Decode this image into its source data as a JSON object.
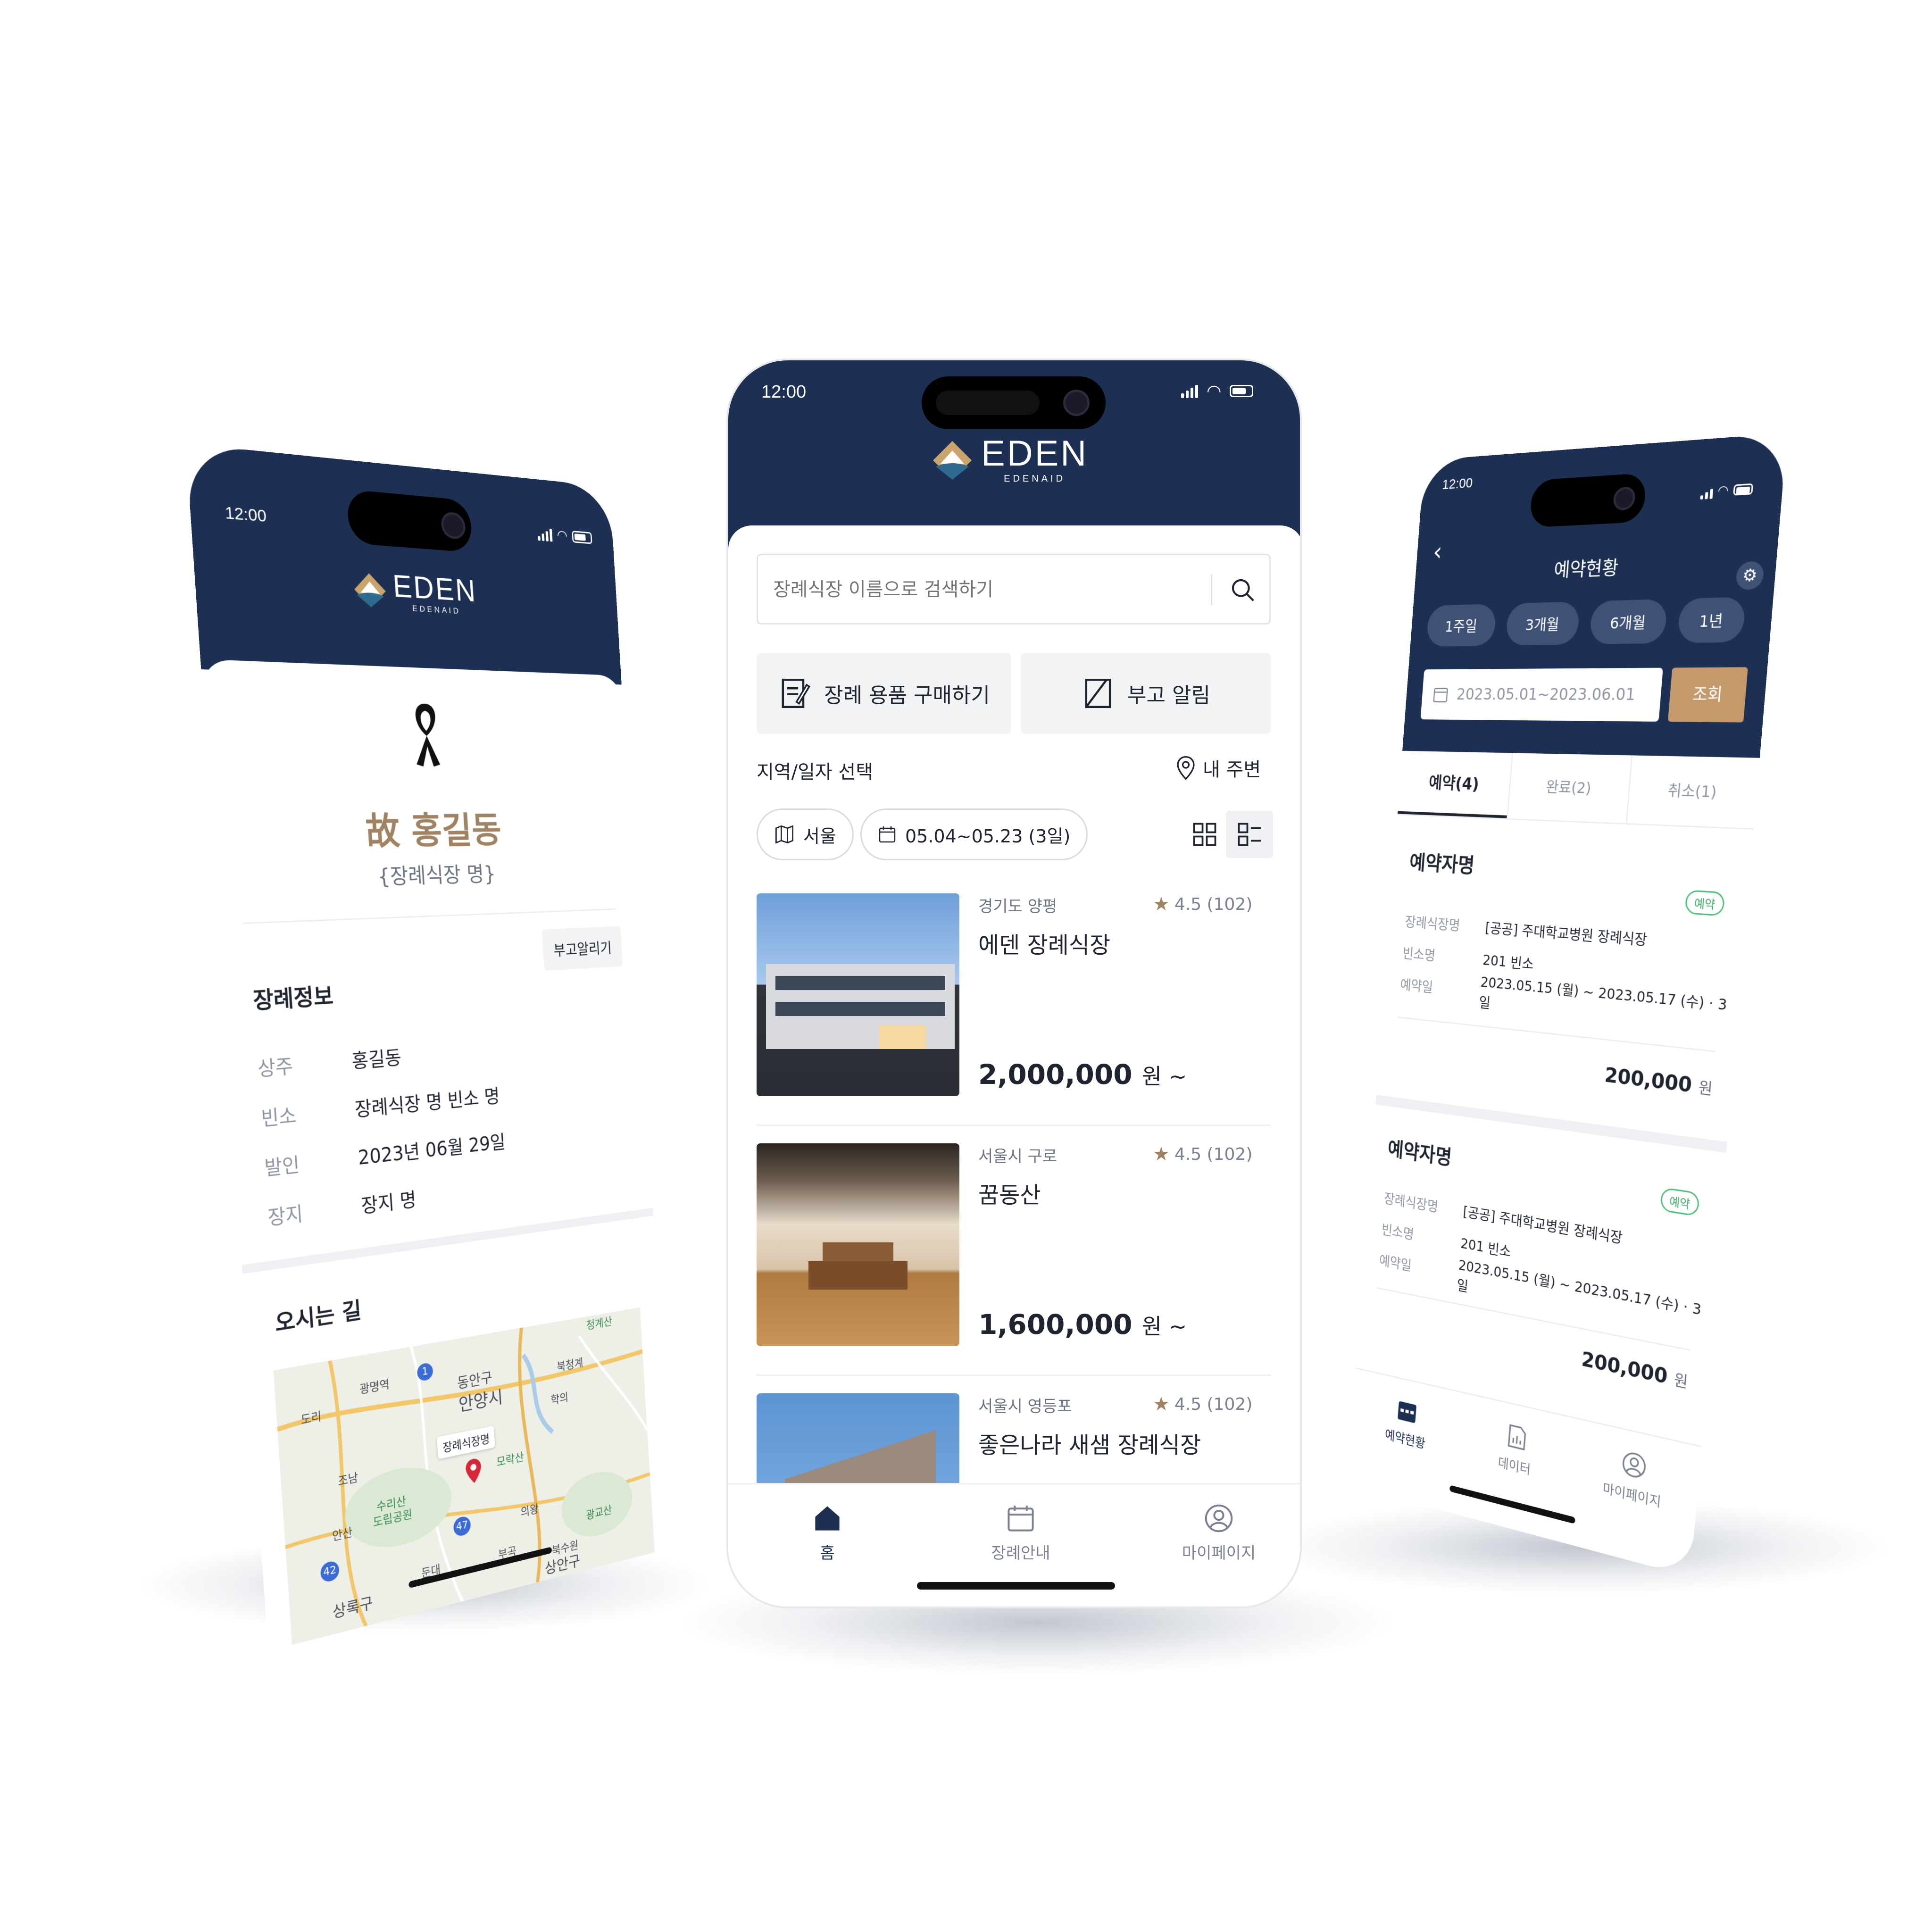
{
  "status_time": "12:00",
  "brand": {
    "name": "EDEN",
    "sub": "EDENAID"
  },
  "left_phone": {
    "deceased_name": "故 홍길동",
    "funeral_hall": "{장례식장 명}",
    "notify_button": "부고알리기",
    "info_title": "장례정보",
    "rows": [
      {
        "label": "상주",
        "value": "홍길동"
      },
      {
        "label": "빈소",
        "value": "장례식장 명 빈소 명"
      },
      {
        "label": "발인",
        "value": "2023년 06월 29일"
      },
      {
        "label": "장지",
        "value": "장지 명"
      }
    ],
    "directions_title": "오시는 길",
    "map": {
      "pin_label": "장례식장명",
      "places": [
        "청계산",
        "광명역",
        "안양시",
        "동안구",
        "북청계",
        "학의",
        "조남",
        "도리",
        "모락산",
        "수리산",
        "도립공원",
        "안산",
        "의왕",
        "광교산",
        "상록구",
        "둔대",
        "부곡",
        "북수원",
        "상안구",
        "1",
        "42",
        "47"
      ]
    }
  },
  "center_phone": {
    "search_placeholder": "장례식장 이름으로 검색하기",
    "buy_goods": "장례 용품 구매하기",
    "obituary": "부고 알림",
    "filter_label": "지역/일자 선택",
    "nearby": "내 주변",
    "region_chip": "서울",
    "date_chip": "05.04~05.23 (3일)",
    "listings": [
      {
        "region": "경기도 양평",
        "name": "에덴 장례식장",
        "rating": "4.5 (102)",
        "price": "2,000,000",
        "unit": "원 ~"
      },
      {
        "region": "서울시 구로",
        "name": "꿈동산",
        "rating": "4.5 (102)",
        "price": "1,600,000",
        "unit": "원 ~"
      },
      {
        "region": "서울시 영등포",
        "name": "좋은나라 새샘 장례식장",
        "rating": "4.5 (102)",
        "price": "",
        "unit": ""
      }
    ],
    "tabs": [
      {
        "label": "홈",
        "icon": "home-icon"
      },
      {
        "label": "장례안내",
        "icon": "calendar-icon"
      },
      {
        "label": "마이페이지",
        "icon": "user-icon"
      }
    ]
  },
  "right_phone": {
    "title": "예약현황",
    "period_chips": [
      "1주일",
      "3개월",
      "6개월",
      "1년"
    ],
    "date_range": "2023.05.01~2023.06.01",
    "search_button": "조회",
    "status_tabs": [
      "예약(4)",
      "완료(2)",
      "취소(1)"
    ],
    "reservations": [
      {
        "name": "예약자명",
        "badge": "예약",
        "fields": [
          {
            "label": "장례식장명",
            "value": "[공공] 주대학교병원 장례식장"
          },
          {
            "label": "빈소명",
            "value": "201 빈소"
          },
          {
            "label": "예약일",
            "value": "2023.05.15 (월) ~ 2023.05.17 (수) · 3일"
          }
        ],
        "amount": "200,000",
        "unit": "원"
      },
      {
        "name": "예약자명",
        "badge": "예약",
        "fields": [
          {
            "label": "장례식장명",
            "value": "[공공] 주대학교병원 장례식장"
          },
          {
            "label": "빈소명",
            "value": "201 빈소"
          },
          {
            "label": "예약일",
            "value": "2023.05.15 (월) ~ 2023.05.17 (수) · 3일"
          }
        ],
        "amount": "200,000",
        "unit": "원"
      }
    ],
    "tabs": [
      {
        "label": "예약현황",
        "icon": "calendar-icon"
      },
      {
        "label": "데이터",
        "icon": "document-icon"
      },
      {
        "label": "마이페이지",
        "icon": "user-icon"
      }
    ]
  },
  "colors": {
    "navy": "#1d2f52",
    "gold": "#a08363",
    "green": "#3aa866"
  }
}
